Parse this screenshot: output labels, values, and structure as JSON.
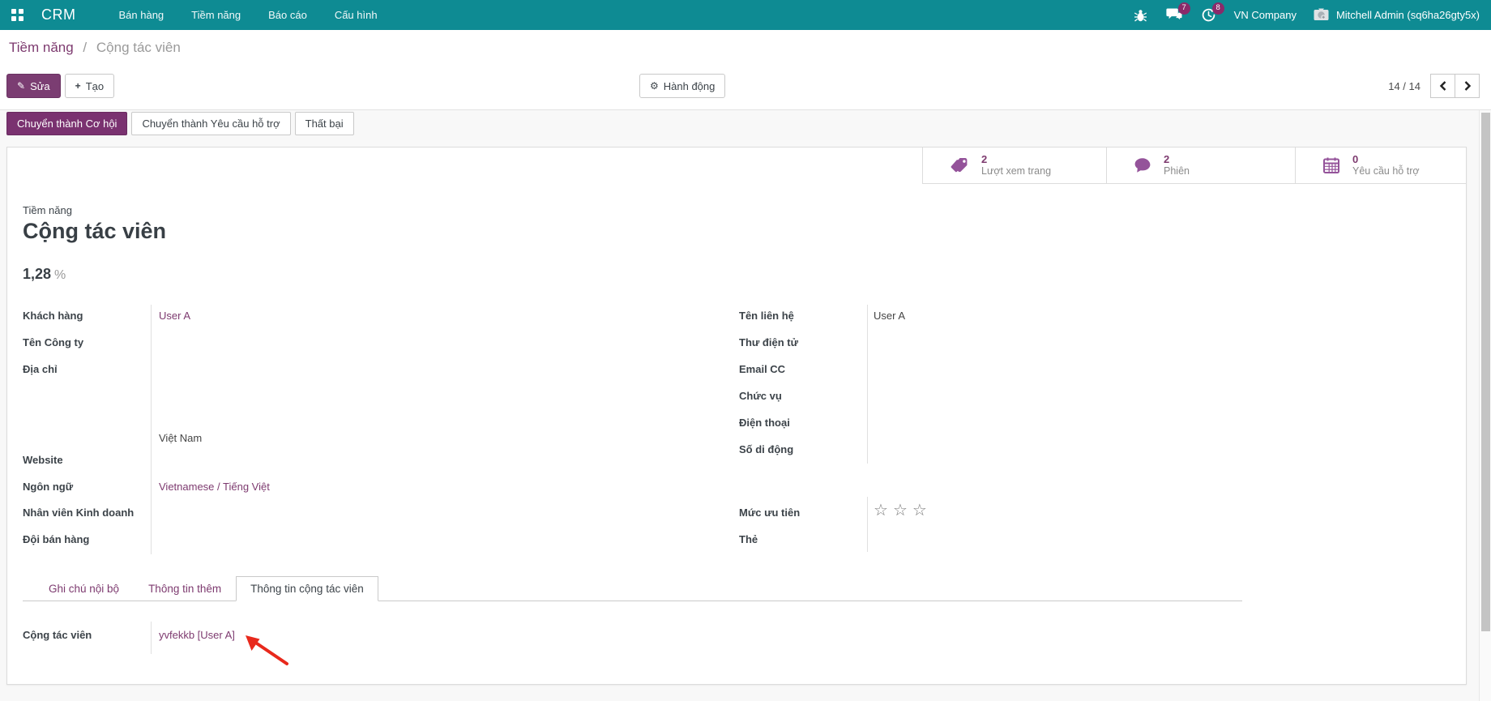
{
  "navbar": {
    "app_name": "CRM",
    "menus": [
      "Bán hàng",
      "Tiềm năng",
      "Báo cáo",
      "Cấu hình"
    ],
    "systray": {
      "messages_badge": "7",
      "activities_badge": "8",
      "company": "VN Company",
      "user": "Mitchell Admin (sq6ha26gty5x)"
    }
  },
  "control_panel": {
    "breadcrumb": {
      "parent": "Tiềm năng",
      "separator": "/",
      "current": "Cộng tác viên"
    },
    "edit_button": "Sửa",
    "create_button": "Tạo",
    "action_button": "Hành động",
    "pager": {
      "text": "14 / 14"
    }
  },
  "statusbar": {
    "convert_opportunity": "Chuyển thành Cơ hội",
    "convert_ticket": "Chuyển thành Yêu cầu hỗ trợ",
    "lost": "Thất bại"
  },
  "stat_buttons": [
    {
      "value": "2",
      "label": "Lượt xem trang"
    },
    {
      "value": "2",
      "label": "Phiên"
    },
    {
      "value": "0",
      "label": "Yêu cầu hỗ trợ"
    }
  ],
  "sheet": {
    "record_type": "Tiềm năng",
    "title": "Cộng tác viên",
    "probability_value": "1,28",
    "probability_suffix": "%",
    "fields": {
      "customer_label": "Khách hàng",
      "customer_value": "User A",
      "company_name_label": "Tên Công ty",
      "address_label": "Địa chỉ",
      "address_country": "Việt Nam",
      "website_label": "Website",
      "language_label": "Ngôn ngữ",
      "language_value": "Vietnamese / Tiếng Việt",
      "salesperson_label": "Nhân viên Kinh doanh",
      "sales_team_label": "Đội bán hàng",
      "contact_name_label": "Tên liên hệ",
      "contact_name_value": "User A",
      "email_label": "Thư điện tử",
      "email_cc_label": "Email CC",
      "job_label": "Chức vụ",
      "phone_label": "Điện thoại",
      "mobile_label": "Số di động",
      "priority_label": "Mức ưu tiên",
      "tags_label": "Thẻ",
      "star_glyph": "☆"
    },
    "tabs": [
      "Ghi chú nội bộ",
      "Thông tin thêm",
      "Thông tin cộng tác viên"
    ],
    "tab_content": {
      "partner_label": "Cộng tác viên",
      "partner_value": "yvfekkb [User A]"
    }
  },
  "colors": {
    "navbar_teal": "#0e8b93",
    "primary_purple": "#7b3d72",
    "link_purple": "#7d3a6f",
    "badge_magenta": "#8a2a6a",
    "stat_icon_purple": "#94539a",
    "annotation_red": "#e8291c"
  }
}
